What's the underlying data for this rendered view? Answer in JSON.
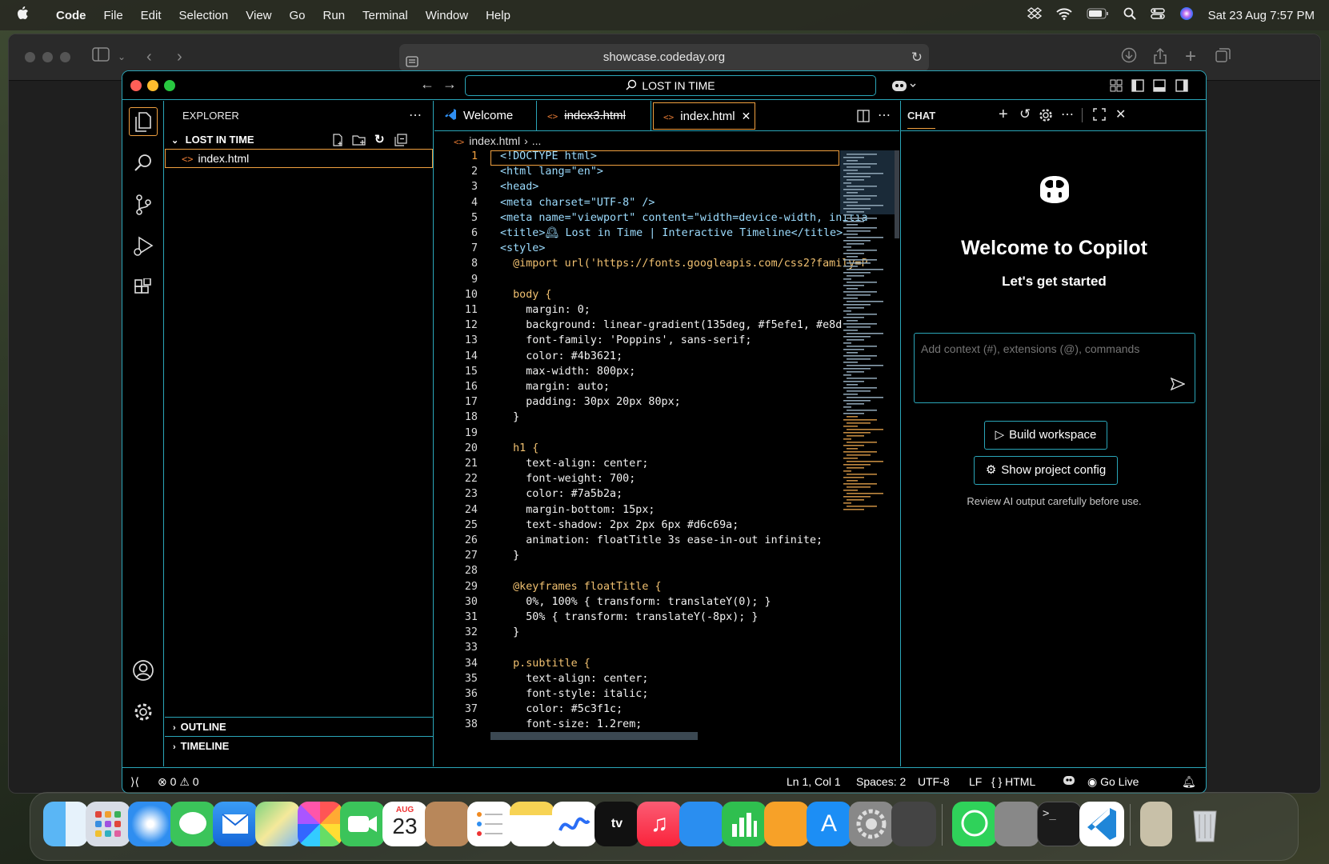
{
  "menubar": {
    "app": "Code",
    "items": [
      "File",
      "Edit",
      "Selection",
      "View",
      "Go",
      "Run",
      "Terminal",
      "Window",
      "Help"
    ],
    "clock": "Sat 23 Aug  7:57 PM"
  },
  "browser": {
    "url": "showcase.codeday.org"
  },
  "vscode": {
    "command_center": "LOST IN TIME",
    "explorer": {
      "title": "EXPLORER",
      "folder": "LOST IN TIME",
      "file": "index.html",
      "outline": "OUTLINE",
      "timeline": "TIMELINE"
    },
    "tabs": [
      {
        "label": "Welcome"
      },
      {
        "label": "index3.html"
      },
      {
        "label": "index.html"
      }
    ],
    "breadcrumb": {
      "file": "index.html",
      "more": "..."
    },
    "code": [
      {
        "n": "1",
        "t": "<!DOCTYPE html>"
      },
      {
        "n": "2",
        "t": "<html lang=\"en\">"
      },
      {
        "n": "3",
        "t": "<head>"
      },
      {
        "n": "4",
        "t": "<meta charset=\"UTF-8\" />"
      },
      {
        "n": "5",
        "t": "<meta name=\"viewport\" content=\"width=device-width, initia"
      },
      {
        "n": "6",
        "t": "<title>🕰 Lost in Time | Interactive Timeline</title>"
      },
      {
        "n": "7",
        "t": "<style>"
      },
      {
        "n": "8",
        "t": "  @import url('https://fonts.googleapis.com/css2?family=P"
      },
      {
        "n": "9",
        "t": ""
      },
      {
        "n": "10",
        "t": "  body {"
      },
      {
        "n": "11",
        "t": "    margin: 0;"
      },
      {
        "n": "12",
        "t": "    background: linear-gradient(135deg, #f5efe1, #e8d"
      },
      {
        "n": "13",
        "t": "    font-family: 'Poppins', sans-serif;"
      },
      {
        "n": "14",
        "t": "    color: #4b3621;"
      },
      {
        "n": "15",
        "t": "    max-width: 800px;"
      },
      {
        "n": "16",
        "t": "    margin: auto;"
      },
      {
        "n": "17",
        "t": "    padding: 30px 20px 80px;"
      },
      {
        "n": "18",
        "t": "  }"
      },
      {
        "n": "19",
        "t": ""
      },
      {
        "n": "20",
        "t": "  h1 {"
      },
      {
        "n": "21",
        "t": "    text-align: center;"
      },
      {
        "n": "22",
        "t": "    font-weight: 700;"
      },
      {
        "n": "23",
        "t": "    color: #7a5b2a;"
      },
      {
        "n": "24",
        "t": "    margin-bottom: 15px;"
      },
      {
        "n": "25",
        "t": "    text-shadow: 2px 2px 6px #d6c69a;"
      },
      {
        "n": "26",
        "t": "    animation: floatTitle 3s ease-in-out infinite;"
      },
      {
        "n": "27",
        "t": "  }"
      },
      {
        "n": "28",
        "t": ""
      },
      {
        "n": "29",
        "t": "  @keyframes floatTitle {"
      },
      {
        "n": "30",
        "t": "    0%, 100% { transform: translateY(0); }"
      },
      {
        "n": "31",
        "t": "    50% { transform: translateY(-8px); }"
      },
      {
        "n": "32",
        "t": "  }"
      },
      {
        "n": "33",
        "t": ""
      },
      {
        "n": "34",
        "t": "  p.subtitle {"
      },
      {
        "n": "35",
        "t": "    text-align: center;"
      },
      {
        "n": "36",
        "t": "    font-style: italic;"
      },
      {
        "n": "37",
        "t": "    color: #5c3f1c;"
      },
      {
        "n": "38",
        "t": "    font-size: 1.2rem;"
      }
    ],
    "chat": {
      "title": "CHAT",
      "welcome": "Welcome to Copilot",
      "subtitle": "Let's get started",
      "input_placeholder": "Add context (#), extensions (@), commands",
      "build_button": "Build workspace",
      "config_button": "Show project config",
      "disclaimer": "Review AI output carefully before use."
    },
    "status": {
      "errors": "0",
      "warnings": "0",
      "position": "Ln 1, Col 1",
      "spaces": "Spaces: 2",
      "encoding": "UTF-8",
      "eol": "LF",
      "language": "HTML",
      "golive": "Go Live"
    }
  },
  "dock": {
    "calendar_month": "AUG",
    "calendar_day": "23"
  },
  "colors": {
    "accent_border": "#2aa5b8",
    "focus_orange": "#f0a040"
  }
}
